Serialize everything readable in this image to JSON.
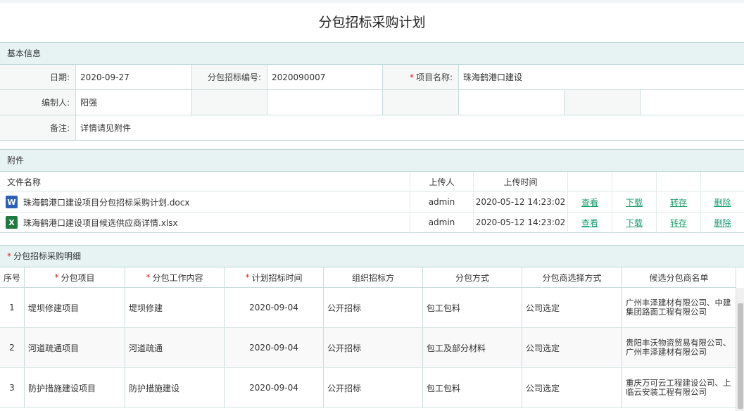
{
  "page": {
    "title": "分包招标采购计划"
  },
  "basic": {
    "header": "基本信息",
    "date_label": "日期:",
    "date_value": "2020-09-27",
    "code_label": "分包招标编号:",
    "code_value": "2020090007",
    "project_label": "项目名称:",
    "project_value": "珠海鹤港口建设",
    "editor_label": "编制人:",
    "editor_value": "阳强",
    "remark_label": "备注:",
    "remark_value": "详情请见附件"
  },
  "attachments": {
    "header": "附件",
    "columns": {
      "name": "文件名称",
      "uploader": "上传人",
      "time": "上传时间"
    },
    "actions": {
      "view": "查看",
      "download": "下载",
      "transfer": "转存",
      "delete": "删除"
    },
    "files": [
      {
        "type": "word",
        "icon_letter": "W",
        "name": "珠海鹤港口建设项目分包招标采购计划.docx",
        "uploader": "admin",
        "time": "2020-05-12 14:23:02"
      },
      {
        "type": "excel",
        "icon_letter": "X",
        "name": "珠海鹤港口建设项目候选供应商详情.xlsx",
        "uploader": "admin",
        "time": "2020-05-12 14:23:02"
      }
    ]
  },
  "details": {
    "header": "分包招标采购明细",
    "columns": {
      "index": "序号",
      "item": "分包项目",
      "content": "分包工作内容",
      "time": "计划招标时间",
      "organizer": "组织招标方",
      "method": "分包方式",
      "selection": "分包商选择方式",
      "candidates": "候选分包商名单"
    },
    "rows": [
      {
        "index": "1",
        "item": "堤坝修建项目",
        "content": "堤坝修建",
        "time": "2020-09-04",
        "organizer": "公开招标",
        "method": "包工包料",
        "selection": "公司选定",
        "candidates": "广州丰泽建材有限公司、中建集团路面工程有限公司"
      },
      {
        "index": "2",
        "item": "河道疏通项目",
        "content": "河道疏通",
        "time": "2020-09-04",
        "organizer": "公开招标",
        "method": "包工及部分材料",
        "selection": "公司选定",
        "candidates": "贵阳丰沃物资贸易有限公司、广州丰泽建材有限公司"
      },
      {
        "index": "3",
        "item": "防护措施建设项目",
        "content": "防护措施建设",
        "time": "2020-09-04",
        "organizer": "公开招标",
        "method": "包工包料",
        "selection": "公司选定",
        "candidates": "重庆万可云工程建设公司、上临云安装工程有限公司"
      }
    ]
  },
  "colors": {
    "section_bg": "#e7f3f3",
    "border": "#c9dcdc",
    "link": "#1a9e6e",
    "required": "#e02020"
  }
}
